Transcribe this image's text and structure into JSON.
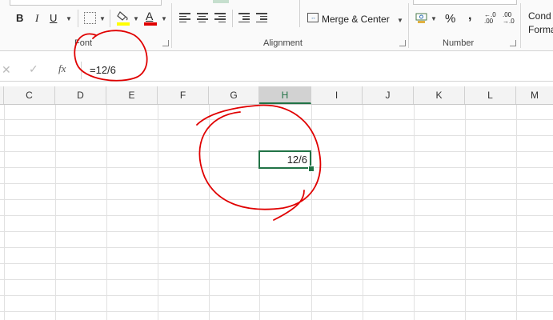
{
  "ribbon": {
    "font_group": {
      "bold_label": "B",
      "italic_label": "I",
      "underline_label": "U",
      "font_color_letter": "A",
      "group_label": "Font"
    },
    "alignment_group": {
      "merge_center_label": "Merge & Center",
      "group_label": "Alignment"
    },
    "number_group": {
      "percent_label": "%",
      "comma_label": ",",
      "increase_decimal_top": "←.0",
      "increase_decimal_bottom": ".00",
      "decrease_decimal_top": ".00",
      "decrease_decimal_bottom": "→.0",
      "group_label": "Number"
    },
    "styles_group": {
      "conditional_line1": "Cond",
      "conditional_line2": "Forma"
    }
  },
  "formula_bar": {
    "cancel_glyph": "✕",
    "enter_glyph": "✓",
    "fx_label": "fx",
    "value": "=12/6"
  },
  "columns": [
    "C",
    "D",
    "E",
    "F",
    "G",
    "H",
    "I",
    "J",
    "K",
    "L",
    "M"
  ],
  "active_column": "H",
  "active_cell": {
    "display": "12/6"
  },
  "colors": {
    "excel_green": "#217346",
    "annotation_red": "#e00000",
    "highlight_yellow": "#ffff00",
    "font_red": "#e00000"
  }
}
